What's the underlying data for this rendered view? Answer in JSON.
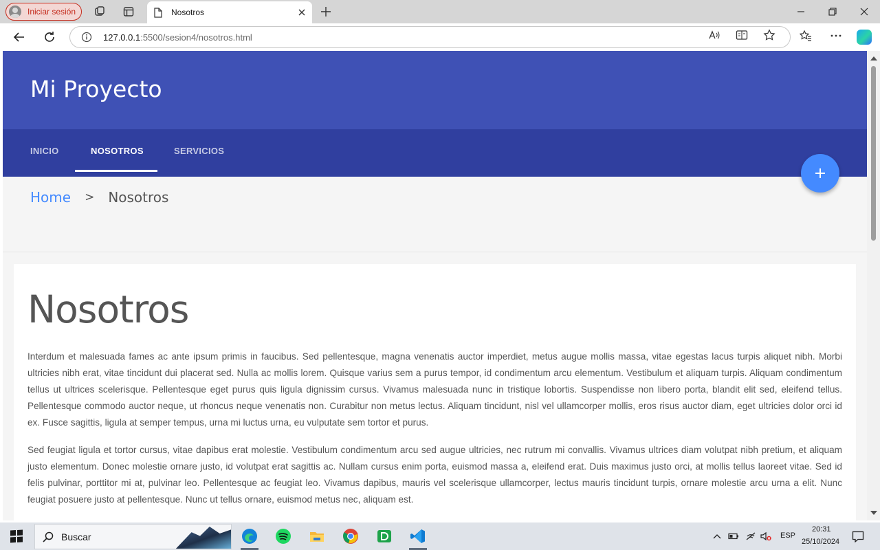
{
  "browser": {
    "profile_label": "Iniciar sesión",
    "tab_title": "Nosotros",
    "url_host": "127.0.0.1",
    "url_path": ":5500/sesion4/nosotros.html"
  },
  "page": {
    "brand": "Mi Proyecto",
    "nav": [
      {
        "label": "INICIO",
        "active": false
      },
      {
        "label": "NOSOTROS",
        "active": true
      },
      {
        "label": "SERVICIOS",
        "active": false
      }
    ],
    "breadcrumb": {
      "home": "Home",
      "separator": ">",
      "current": "Nosotros"
    },
    "heading": "Nosotros",
    "paragraphs": [
      "Interdum et malesuada fames ac ante ipsum primis in faucibus. Sed pellentesque, magna venenatis auctor imperdiet, metus augue mollis massa, vitae egestas lacus turpis aliquet nibh. Morbi ultricies nibh erat, vitae tincidunt dui placerat sed. Nulla ac mollis lorem. Quisque varius sem a purus tempor, id condimentum arcu elementum. Vestibulum et aliquam turpis. Aliquam condimentum tellus ut ultrices scelerisque. Pellentesque eget purus quis ligula dignissim cursus. Vivamus malesuada nunc in tristique lobortis. Suspendisse non libero porta, blandit elit sed, eleifend tellus. Pellentesque commodo auctor neque, ut rhoncus neque venenatis non. Curabitur non metus lectus. Aliquam tincidunt, nisl vel ullamcorper mollis, eros risus auctor diam, eget ultricies dolor orci id ex. Fusce sagittis, ligula at semper tempus, urna mi luctus urna, eu vulputate sem tortor et purus.",
      "Sed feugiat ligula et tortor cursus, vitae dapibus erat molestie. Vestibulum condimentum arcu sed augue ultricies, nec rutrum mi convallis. Vivamus ultrices diam volutpat nibh pretium, et aliquam justo elementum. Donec molestie ornare justo, id volutpat erat sagittis ac. Nullam cursus enim porta, euismod massa a, eleifend erat. Duis maximus justo orci, at mollis tellus laoreet vitae. Sed id felis pulvinar, porttitor mi at, pulvinar leo. Pellentesque ac feugiat leo. Vivamus dapibus, mauris vel scelerisque ullamcorper, lectus mauris tincidunt turpis, ornare molestie arcu urna a elit. Nunc feugiat posuere justo at pellentesque. Nunc ut tellus ornare, euismod metus nec, aliquam est."
    ],
    "colors": {
      "primary": "#3f51b5",
      "primary_dark": "#303f9f",
      "accent": "#448aff"
    }
  },
  "taskbar": {
    "search_placeholder": "Buscar",
    "language": "ESP",
    "time": "20:31",
    "date": "25/10/2024",
    "apps": [
      "edge-icon",
      "spotify-icon",
      "file-explorer-icon",
      "chrome-icon",
      "dbeaver-icon",
      "vscode-icon"
    ]
  }
}
